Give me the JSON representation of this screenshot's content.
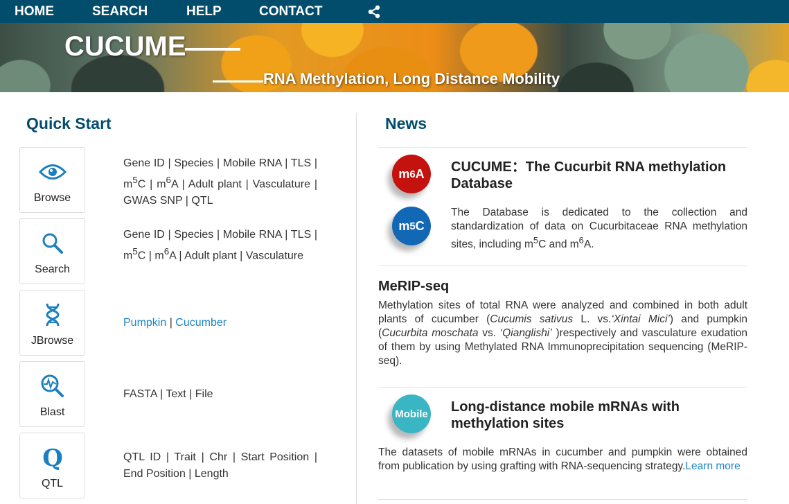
{
  "nav": {
    "home": "HOME",
    "search": "SEARCH",
    "help": "HELP",
    "contact": "CONTACT",
    "share_icon": "share-icon"
  },
  "banner": {
    "title": "CUCUME",
    "subtitle": "RNA Methylation, Long Distance Mobility"
  },
  "quick_start": {
    "title": "Quick Start",
    "cards": [
      {
        "label": "Browse",
        "icon": "eye-icon",
        "desc_html": "Gene ID | Species | Mobile RNA | TLS | m<sup>5</sup>C | m<sup>6</sup>A | Adult plant | Vasculature | GWAS SNP | QTL"
      },
      {
        "label": "Search",
        "icon": "magnifier-icon",
        "desc_html": "Gene ID | Species | Mobile RNA | TLS | m<sup>5</sup>C | m<sup>6</sup>A | Adult plant | Vasculature"
      },
      {
        "label": "JBrowse",
        "icon": "dna-icon",
        "links": [
          "Pumpkin",
          "Cucumber"
        ]
      },
      {
        "label": "Blast",
        "icon": "blast-search-icon",
        "desc_text": "FASTA | Text | File"
      },
      {
        "label": "QTL",
        "icon": "q-icon",
        "desc_text": "QTL ID | Trait | Chr | Start Position | End Position | Length"
      }
    ]
  },
  "news": {
    "title": "News",
    "item1": {
      "badge_a": "m<sup>6</sup>A",
      "badge_b": "m<sup>5</sup>C",
      "heading": "CUCUME：The Cucurbit RNA methylation Database",
      "body_html": "The Database is dedicated to the collection and standardization of data on Cucurbitaceae RNA methylation sites, including m<sup>5</sup>C and m<sup>6</sup>A."
    },
    "item2": {
      "heading": "MeRIP-seq",
      "body_html": "Methylation sites of total RNA were analyzed and combined in both adult plants of cucumber (<i>Cucumis sativus</i> L. vs.<i>‘Xintai Mici’</i>) and pumpkin (<i>Cucurbita moschata</i> vs. <i>‘Qianglishi’</i> )respectively and vasculature exudation of them by using Methylated RNA Immunoprecipitation sequencing (MeRIP-seq)."
    },
    "item3": {
      "badge": "Mobile",
      "heading": "Long-distance mobile mRNAs with methylation sites",
      "body": "The datasets of mobile mRNAs in cucumber and pumpkin were obtained from publication by using grafting with RNA-sequencing strategy.",
      "link": "Learn more"
    }
  },
  "colors": {
    "nav": "#024d6b",
    "accent_title": "#024d6b",
    "link": "#1b84c4",
    "m6a": "#c4120f",
    "m5c": "#1368b6",
    "mobile": "#3ab5c4"
  }
}
